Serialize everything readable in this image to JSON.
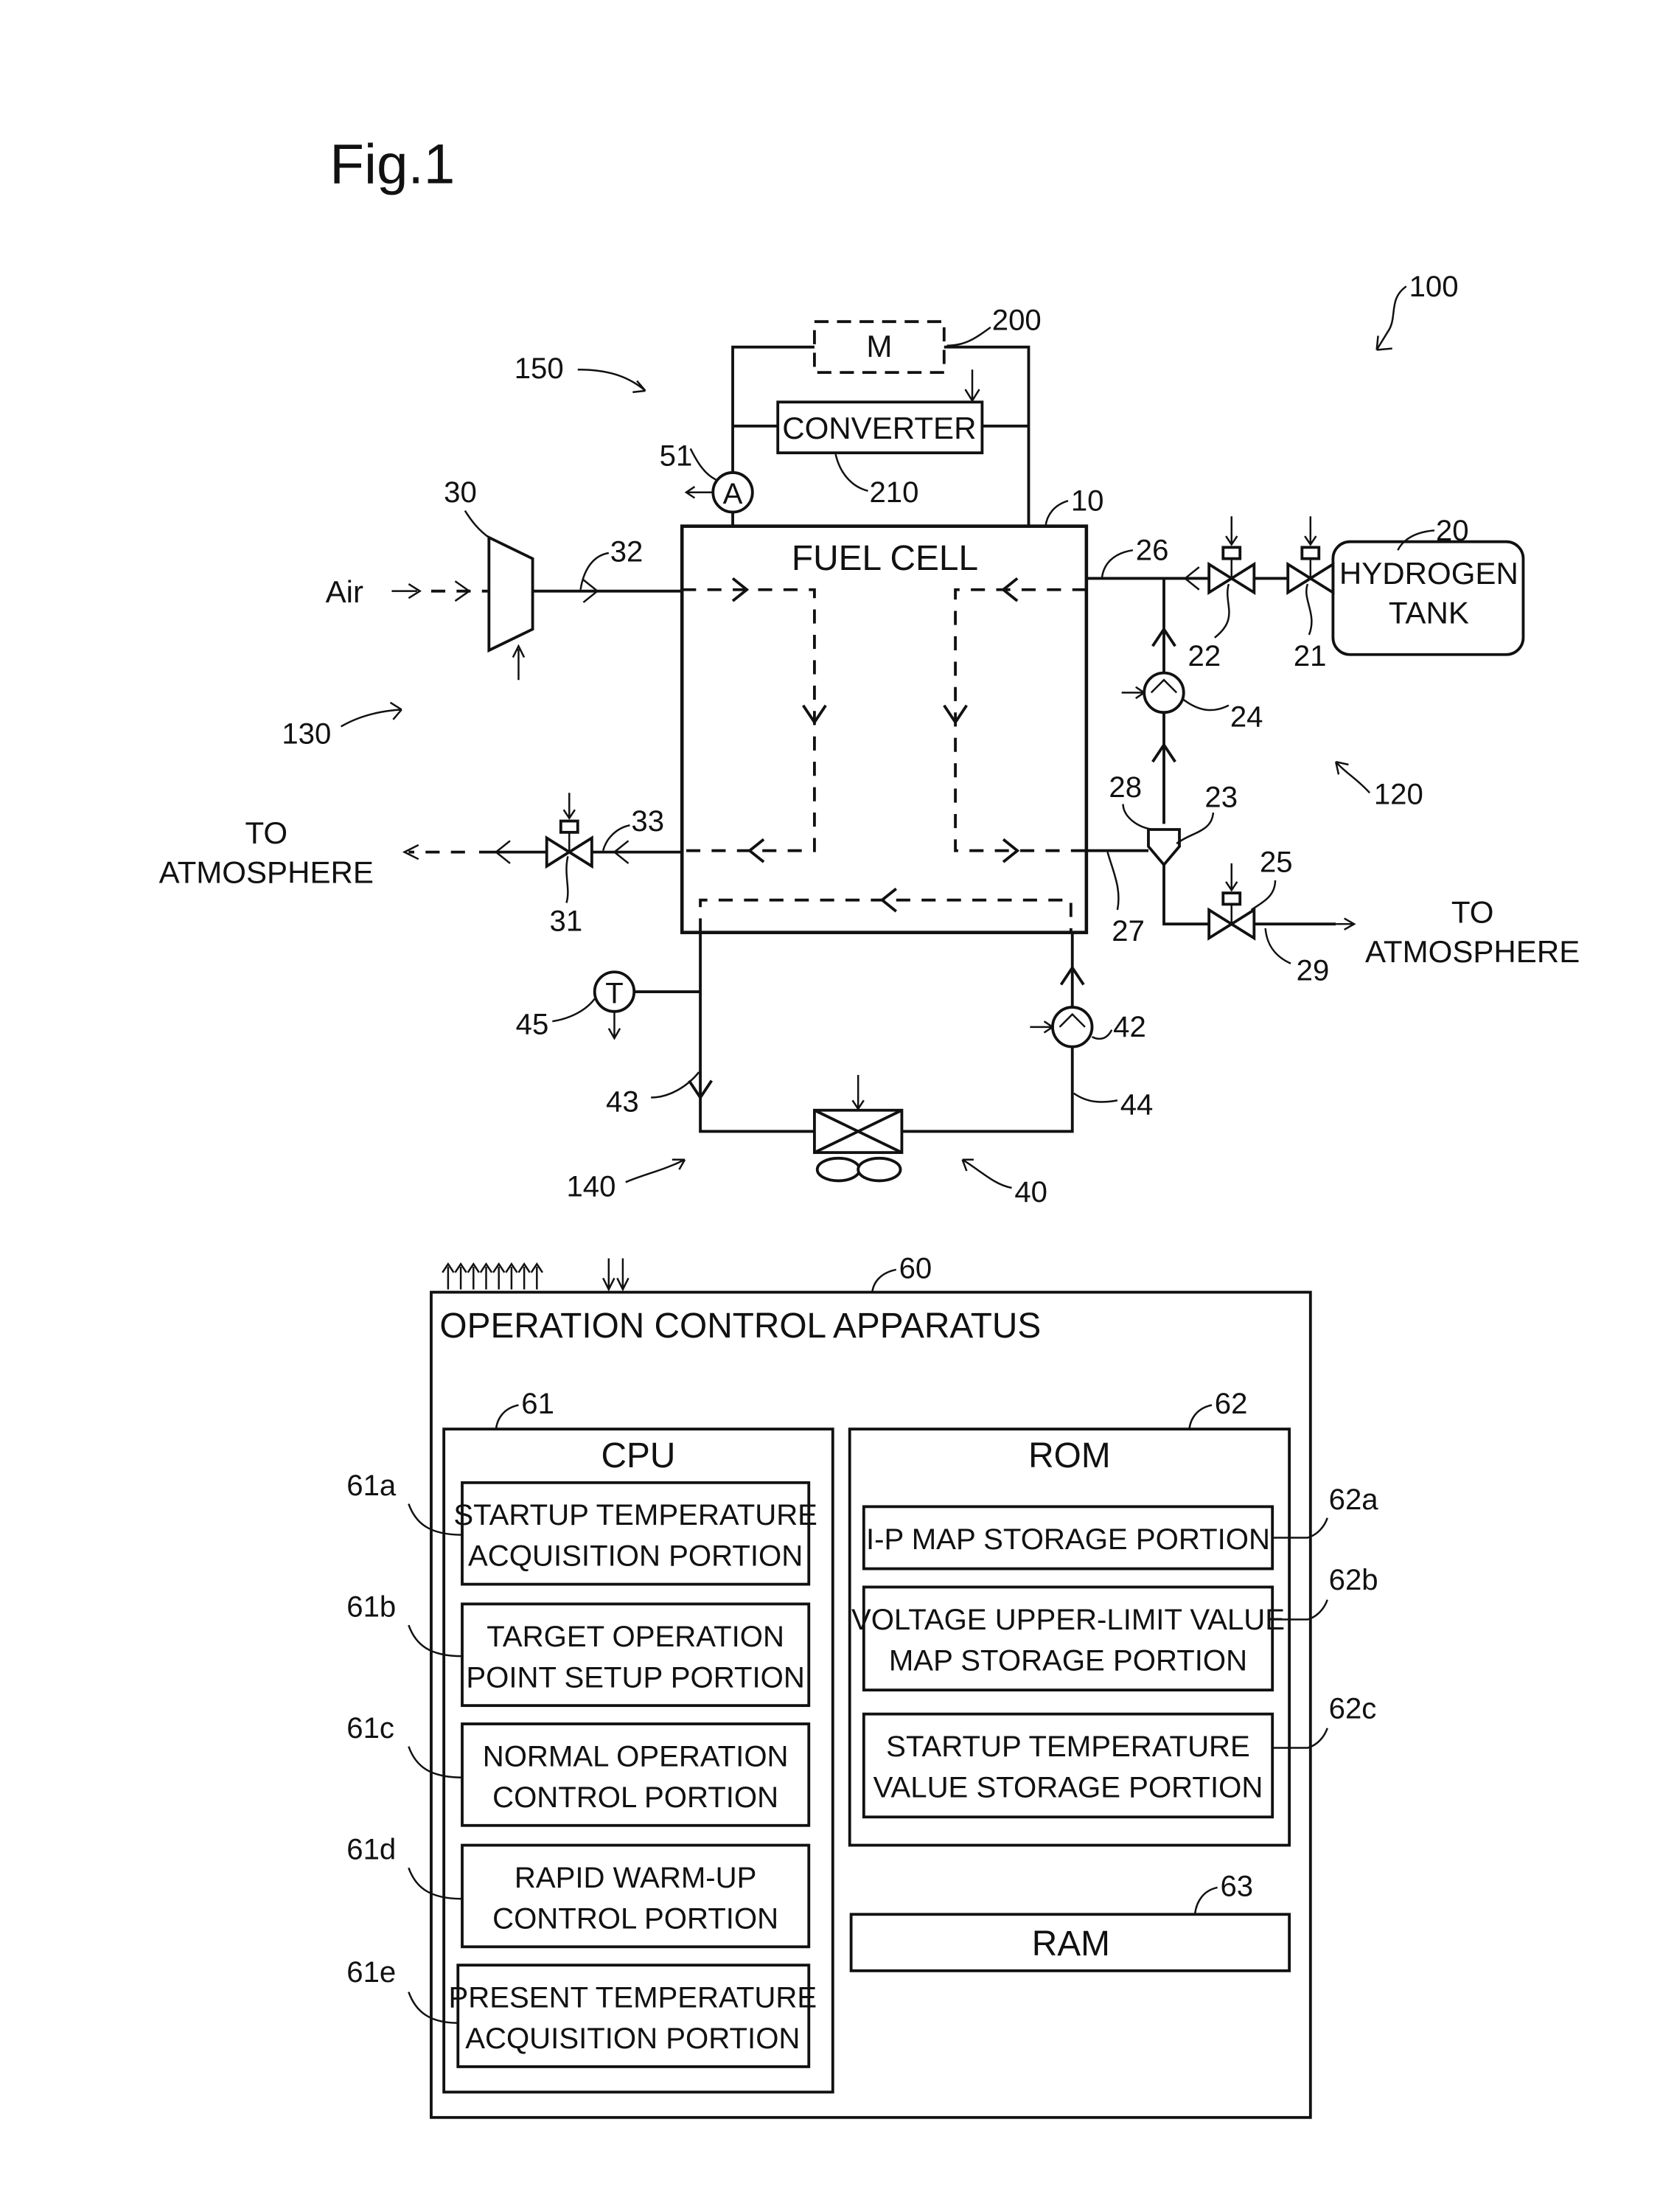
{
  "figure": {
    "title": "Fig.1",
    "system_ref": "100"
  },
  "power": {
    "ref": "150",
    "motor_label": "M",
    "motor_ref": "200",
    "converter_label": "CONVERTER",
    "converter_ref": "210",
    "ammeter_label": "A",
    "ammeter_ref": "51"
  },
  "fuel_cell": {
    "label": "FUEL CELL",
    "ref": "10"
  },
  "air_system": {
    "ref": "130",
    "air_label": "Air",
    "compressor_ref": "30",
    "supply_pipe_ref": "32",
    "exhaust_pipe_ref": "33",
    "pressure_valve_ref": "31",
    "outlet_label_line1": "TO",
    "outlet_label_line2": "ATMOSPHERE"
  },
  "hydrogen_system": {
    "ref": "120",
    "tank_label_line1": "HYDROGEN",
    "tank_label_line2": "TANK",
    "tank_ref": "20",
    "shutoff_valve_ref": "21",
    "regulator_valve_ref": "22",
    "gas_liquid_separator_ref": "23",
    "circulation_pump_ref": "24",
    "purge_valve_ref": "25",
    "supply_pipe_ref": "26",
    "exhaust_pipe_ref": "27",
    "circulation_pipe_ref": "28",
    "purge_pipe_ref": "29",
    "outlet_label_line1": "TO",
    "outlet_label_line2": "ATMOSPHERE"
  },
  "cooling_system": {
    "ref": "140",
    "radiator_ref": "40",
    "pump_ref": "42",
    "outlet_pipe_ref": "43",
    "inlet_pipe_ref": "44",
    "temp_sensor_label": "T",
    "temp_sensor_ref": "45"
  },
  "controller": {
    "title": "OPERATION CONTROL APPARATUS",
    "ref": "60",
    "cpu": {
      "title": "CPU",
      "ref": "61",
      "portions": [
        {
          "ref": "61a",
          "line1": "STARTUP TEMPERATURE",
          "line2": "ACQUISITION PORTION"
        },
        {
          "ref": "61b",
          "line1": "TARGET OPERATION",
          "line2": "POINT SETUP PORTION"
        },
        {
          "ref": "61c",
          "line1": "NORMAL OPERATION",
          "line2": "CONTROL PORTION"
        },
        {
          "ref": "61d",
          "line1": "RAPID WARM-UP",
          "line2": "CONTROL PORTION"
        },
        {
          "ref": "61e",
          "line1": "PRESENT TEMPERATURE",
          "line2": "ACQUISITION PORTION"
        }
      ]
    },
    "rom": {
      "title": "ROM",
      "ref": "62",
      "portions": [
        {
          "ref": "62a",
          "line1": "I-P MAP STORAGE PORTION",
          "line2": ""
        },
        {
          "ref": "62b",
          "line1": "VOLTAGE UPPER-LIMIT VALUE",
          "line2": "MAP STORAGE PORTION"
        },
        {
          "ref": "62c",
          "line1": "STARTUP TEMPERATURE",
          "line2": "VALUE STORAGE PORTION"
        }
      ]
    },
    "ram": {
      "title": "RAM",
      "ref": "63"
    }
  }
}
